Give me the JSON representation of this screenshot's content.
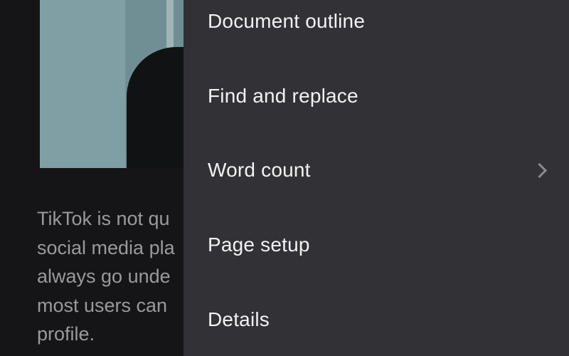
{
  "document": {
    "text_lines": [
      "TikTok is not qu",
      "social media pla",
      "always go unde",
      "most users can",
      "profile."
    ]
  },
  "menu": {
    "items": [
      {
        "label": "Document outline",
        "has_submenu": false
      },
      {
        "label": "Find and replace",
        "has_submenu": false
      },
      {
        "label": "Word count",
        "has_submenu": true,
        "icon": "chevron-right-icon"
      },
      {
        "label": "Page setup",
        "has_submenu": false
      },
      {
        "label": "Details",
        "has_submenu": false
      }
    ]
  },
  "colors": {
    "menu_background": "#323135",
    "menu_text": "#f2f2f4",
    "document_background": "#151517",
    "document_text": "#9a9a9e",
    "chevron": "#8a898e"
  }
}
